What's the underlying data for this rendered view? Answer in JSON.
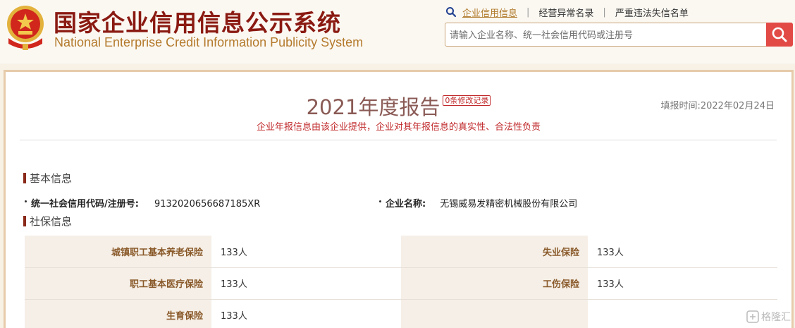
{
  "header": {
    "title_cn": "国家企业信用信息公示系统",
    "title_en": "National Enterprise Credit Information Publicity System"
  },
  "nav": {
    "items": [
      {
        "label": "企业信用信息",
        "active": true
      },
      {
        "label": "经营异常名录",
        "active": false
      },
      {
        "label": "严重违法失信名单",
        "active": false
      }
    ]
  },
  "search": {
    "placeholder": "请输入企业名称、统一社会信用代码或注册号",
    "value": ""
  },
  "report": {
    "title": "2021年度报告",
    "badge": "0条修改记录",
    "date": "填报时间:2022年02月24日",
    "note": "企业年报信息由该企业提供，企业对其年报信息的真实性、合法性负责"
  },
  "basic": {
    "heading": "基本信息",
    "credit_label": "统一社会信用代码/注册号:",
    "credit_value": "9132020656687185XR",
    "name_label": "企业名称:",
    "name_value": "无锡威易发精密机械股份有限公司"
  },
  "social": {
    "heading": "社保信息",
    "rows": [
      [
        {
          "k": "城镇职工基本养老保险",
          "v": "133人"
        },
        {
          "k": "失业保险",
          "v": "133人"
        }
      ],
      [
        {
          "k": "职工基本医疗保险",
          "v": "133人"
        },
        {
          "k": "工伤保险",
          "v": "133人"
        }
      ],
      [
        {
          "k": "生育保险",
          "v": "133人"
        },
        {
          "k": "",
          "v": ""
        }
      ]
    ]
  },
  "watermark": "格隆汇",
  "colors": {
    "brand": "#8a1a12",
    "accent": "#b07a2a",
    "search_button": "#e24a46",
    "warning": "#c0282a"
  }
}
